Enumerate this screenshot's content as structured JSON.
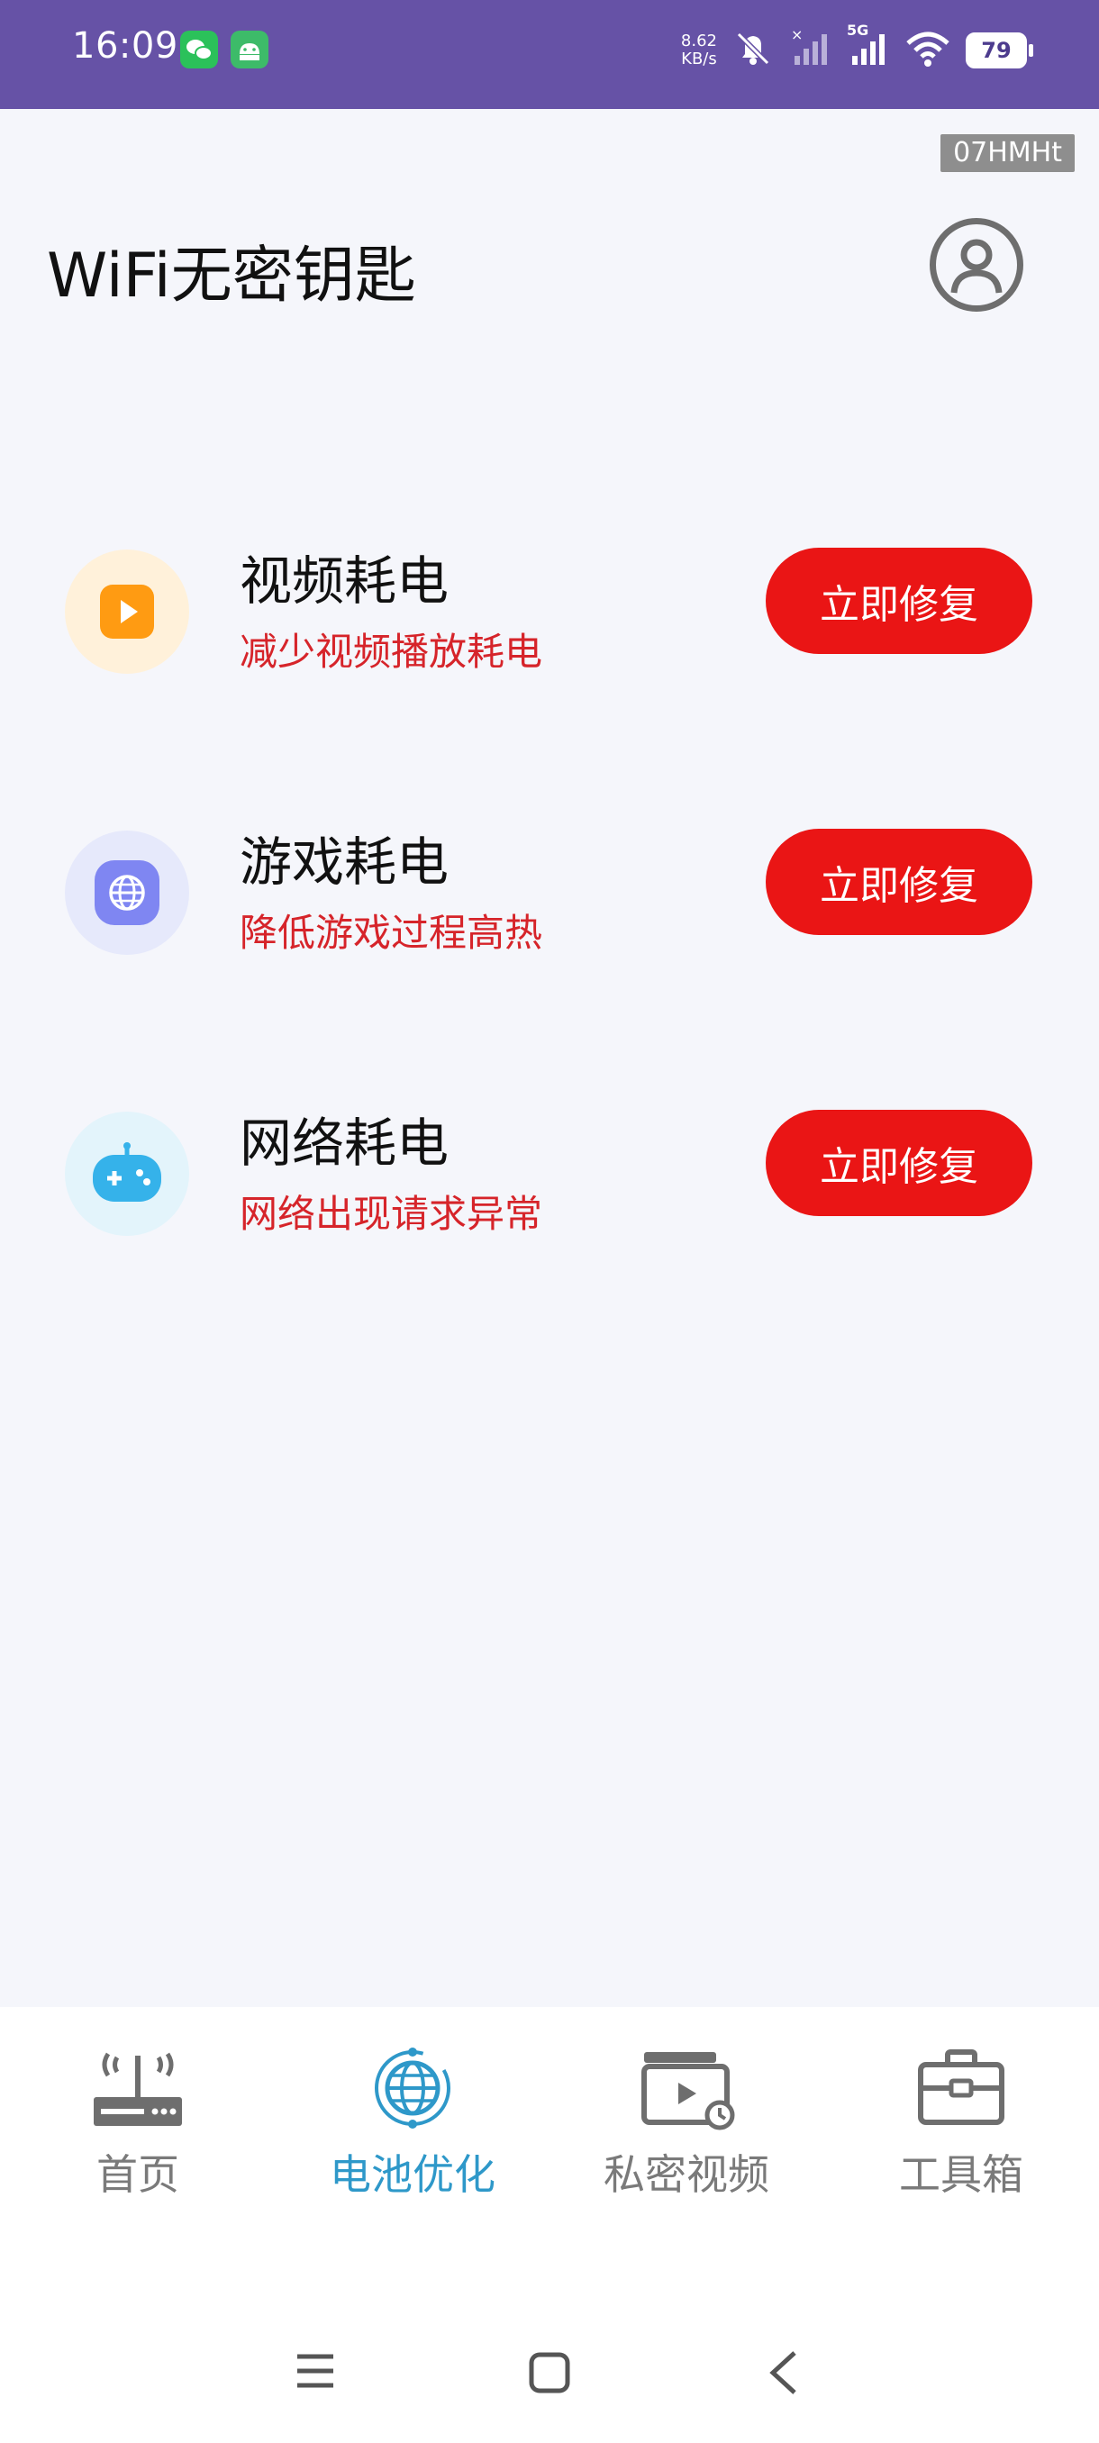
{
  "status_bar": {
    "time": "16:09",
    "net_speed_value": "8.62",
    "net_speed_unit": "KB/s",
    "network_type": "5G",
    "battery": "79"
  },
  "tag_badge": "07HMHt",
  "app_title": "WiFi无密钥匙",
  "items": [
    {
      "title": "视频耗电",
      "subtitle": "减少视频播放耗电",
      "button": "立即修复",
      "icon": "video-icon",
      "icon_bg": "#FFF1DA",
      "icon_color": "#FF9B12"
    },
    {
      "title": "游戏耗电",
      "subtitle": "降低游戏过程高热",
      "button": "立即修复",
      "icon": "globe-icon",
      "icon_bg": "#E6E9FB",
      "icon_color": "#7F86F2"
    },
    {
      "title": "网络耗电",
      "subtitle": "网络出现请求异常",
      "button": "立即修复",
      "icon": "gamepad-icon",
      "icon_bg": "#E3F4FB",
      "icon_color": "#35B2EA"
    }
  ],
  "nav": [
    {
      "label": "首页",
      "icon": "router-icon",
      "active": false
    },
    {
      "label": "电池优化",
      "icon": "globe-icon",
      "active": true
    },
    {
      "label": "私密视频",
      "icon": "video-folder-icon",
      "active": false
    },
    {
      "label": "工具箱",
      "icon": "toolbox-icon",
      "active": false
    }
  ],
  "colors": {
    "status_bar": "#6652A6",
    "accent": "#2E98C9",
    "fix_button": "#EA1515",
    "subtitle": "#D6242A"
  }
}
